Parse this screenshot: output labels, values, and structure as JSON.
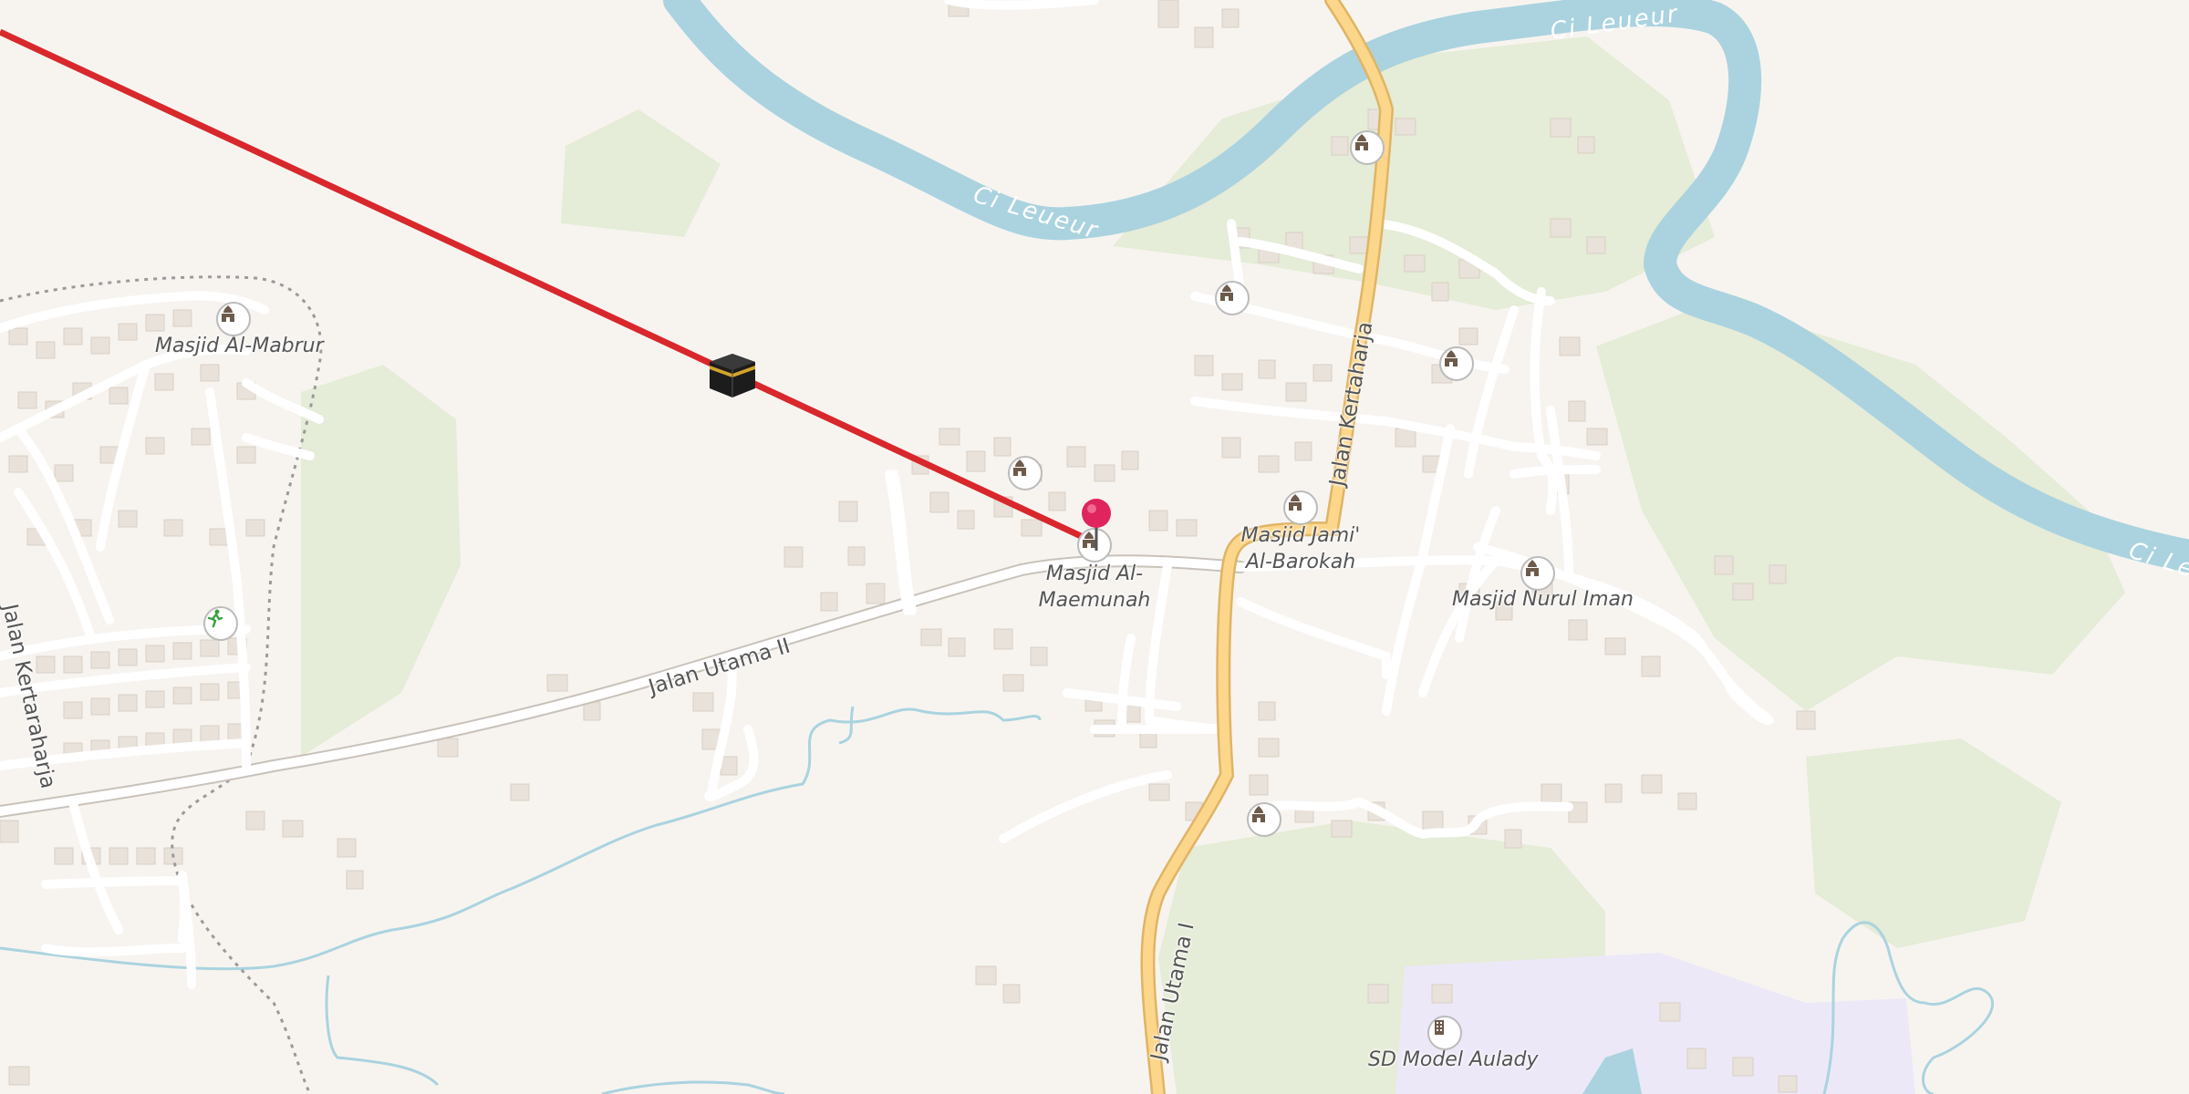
{
  "map": {
    "colors": {
      "background": "#f7f4f0",
      "water": "#aad3df",
      "road_minor": "#ffffff",
      "road_primary": "#fcd68a",
      "qibla_line": "#d8282c",
      "marker": "#e0245e",
      "park": "#dfeacf",
      "school_area": "#ede8f8"
    },
    "markers": {
      "location_pin": "current-location-pin",
      "kaaba": "kaaba-icon"
    },
    "roads": {
      "jalan_utama_ii": "Jalan Utama II",
      "jalan_utama_i": "Jalan Utama I",
      "jalan_kertaharja": "Jalan Kertaharja",
      "jalan_kertaraharja": "Jalan Kertaraharja"
    },
    "rivers": {
      "ci_leueur_1": "Ci Leueur",
      "ci_leueur_2": "Ci Leueur",
      "ci_leueur_3": "Ci Le"
    },
    "places": {
      "masjid_al_mabrur": "Masjid Al-Mabrur",
      "masjid_al_maemunah_1": "Masjid Al-",
      "masjid_al_maemunah_2": "Maemunah",
      "masjid_jami_1": "Masjid Jami'",
      "masjid_jami_2": "Al-Barokah",
      "masjid_nurul_iman": "Masjid Nurul Iman",
      "sd_model_aulady": "SD Model Aulady"
    }
  }
}
